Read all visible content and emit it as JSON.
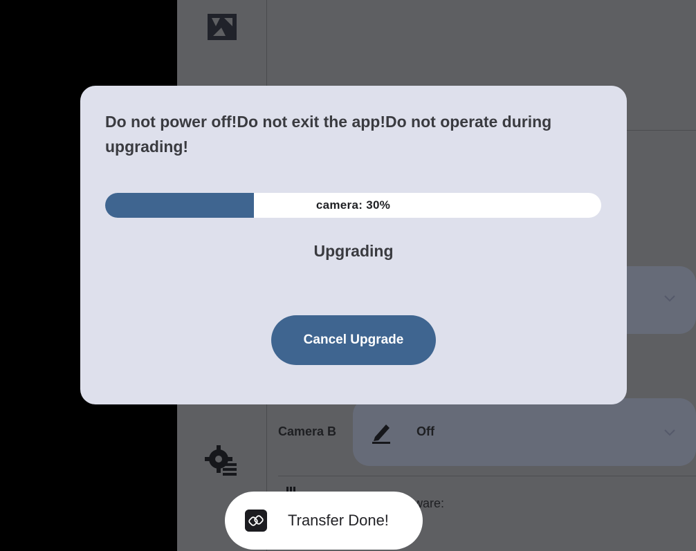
{
  "dialog": {
    "warning": "Do not power off!Do not exit the app!Do not operate during upgrading!",
    "progress_label": "camera: 30%",
    "progress_value": 0.3,
    "status": "Upgrading",
    "cancel_label": "Cancel Upgrade"
  },
  "background": {
    "camera_b_label": "Camera B",
    "camera_b_value": "Off",
    "firmware_label_partial": "ware:"
  },
  "toast": {
    "message": "Transfer Done!"
  },
  "icons": {
    "rail_top": "gallery-icon",
    "rail_bottom": "settings-icon",
    "toast": "link-icon"
  },
  "colors": {
    "accent": "#3f6590",
    "dialog_bg": "#dee0ec",
    "backdrop": "#5e5f62"
  }
}
